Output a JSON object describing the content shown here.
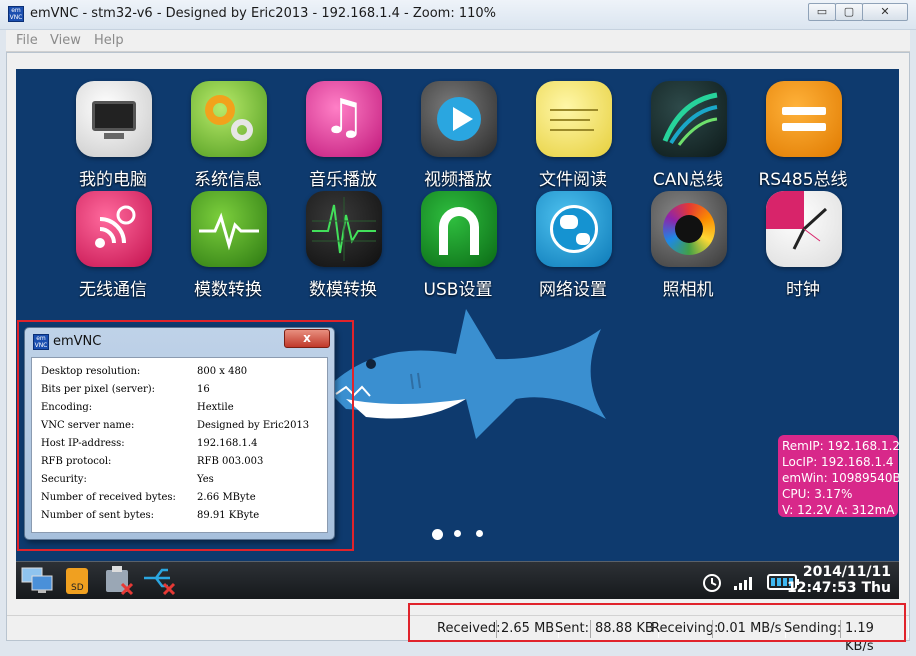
{
  "window": {
    "title": "emVNC - stm32-v6 - Designed by Eric2013 - 192.168.1.4 - Zoom: 110%",
    "icon_text": "em VNC",
    "minimize": "▭",
    "maximize": "▢",
    "close": "✕"
  },
  "menu": {
    "file": "File",
    "view": "View",
    "help": "Help"
  },
  "apps": [
    {
      "label": "我的电脑",
      "icon": "computer-icon"
    },
    {
      "label": "系统信息",
      "icon": "gears-icon"
    },
    {
      "label": "音乐播放",
      "icon": "music-note-icon"
    },
    {
      "label": "视频播放",
      "icon": "play-icon"
    },
    {
      "label": "文件阅读",
      "icon": "sticky-note-icon"
    },
    {
      "label": "CAN总线",
      "icon": "can-bus-icon"
    },
    {
      "label": "RS485总线",
      "icon": "rs485-icon"
    },
    {
      "label": "无线通信",
      "icon": "wireless-icon"
    },
    {
      "label": "模数转换",
      "icon": "waveform-icon"
    },
    {
      "label": "数模转换",
      "icon": "oscilloscope-icon"
    },
    {
      "label": "USB设置",
      "icon": "usb-icon"
    },
    {
      "label": "网络设置",
      "icon": "globe-icon"
    },
    {
      "label": "照相机",
      "icon": "camera-icon"
    },
    {
      "label": "时钟",
      "icon": "clock-icon"
    }
  ],
  "sysinfo": {
    "remip": "RemIP: 192.168.1.2",
    "locip": "LocIP: 192.168.1.4",
    "emwin": "emWin: 10989540B",
    "cpu": "CPU:  3.17%",
    "power": "V: 12.2V    A: 312mA"
  },
  "taskbar": {
    "date": "2014/11/11",
    "time": "12:47:53 Thu"
  },
  "dialog": {
    "title": "emVNC",
    "close": "x",
    "rows": [
      {
        "k": "Desktop resolution:",
        "v": "800 x 480"
      },
      {
        "k": "Bits per pixel (server):",
        "v": "16"
      },
      {
        "k": "Encoding:",
        "v": "Hextile"
      },
      {
        "k": "VNC server name:",
        "v": "Designed by Eric2013"
      },
      {
        "k": "Host IP-address:",
        "v": "192.168.1.4"
      },
      {
        "k": "RFB protocol:",
        "v": "RFB 003.003"
      },
      {
        "k": "Security:",
        "v": "Yes"
      },
      {
        "k": "Number of received bytes:",
        "v": "2.66 MByte"
      },
      {
        "k": "Number of sent bytes:",
        "v": "89.91 KByte"
      }
    ]
  },
  "status": {
    "received_label": "Received:",
    "received_value": "2.65 MB",
    "sent_label": "Sent:",
    "sent_value": "88.88 KB",
    "receiving_label": "Receiving:",
    "receiving_value": "0.01 MB/s",
    "sending_label": "Sending:",
    "sending_value": "1.19 KB/s"
  },
  "colors": {
    "desktop_bg": "#0e3a6e",
    "sysinfo_bg": "#d8288a",
    "highlight": "#e0232b"
  }
}
